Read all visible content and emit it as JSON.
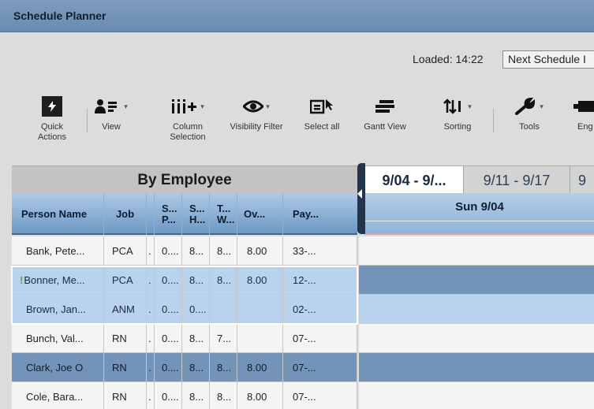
{
  "window": {
    "title": "Schedule Planner"
  },
  "status": {
    "loaded": "Loaded: 14:22",
    "next_button": "Next Schedule I"
  },
  "toolbar": {
    "quick_actions": "Quick Actions",
    "view": "View",
    "column_selection": "Column Selection",
    "visibility_filter": "Visibility Filter",
    "select_all": "Select all",
    "gantt_view": "Gantt View",
    "sorting": "Sorting",
    "tools": "Tools",
    "engine": "Eng"
  },
  "grid": {
    "group_title": "By Employee",
    "headers": {
      "name": "Person Name",
      "job": "Job",
      "c1": "S... P...",
      "c2": "S... H...",
      "c3": "T... W...",
      "ov": "Ov...",
      "pay": "Pay..."
    },
    "rows": [
      {
        "name": "Bank, Pete...",
        "job": "PCA",
        "c1": "0....",
        "c2": "8...",
        "c3": "8...",
        "ov": "8.00",
        "pay": "33-...",
        "flag": ""
      },
      {
        "name": "Bonner, Me...",
        "job": "PCA",
        "c1": "0....",
        "c2": "8...",
        "c3": "8...",
        "ov": "8.00",
        "pay": "12-...",
        "flag": "!"
      },
      {
        "name": "Brown, Jan...",
        "job": "ANM",
        "c1": "0....",
        "c2": "0....",
        "c3": "",
        "ov": "",
        "pay": "02-...",
        "flag": ""
      },
      {
        "name": "Bunch, Val...",
        "job": "RN",
        "c1": "0....",
        "c2": "8...",
        "c3": "7...",
        "ov": "",
        "pay": "07-...",
        "flag": ""
      },
      {
        "name": "Clark, Joe O",
        "job": "RN",
        "c1": "0....",
        "c2": "8...",
        "c3": "8...",
        "ov": "8.00",
        "pay": "07-...",
        "flag": ""
      },
      {
        "name": "Cole, Bara...",
        "job": "RN",
        "c1": "0....",
        "c2": "8...",
        "c3": "8...",
        "ov": "8.00",
        "pay": "07-...",
        "flag": ""
      }
    ]
  },
  "calendar": {
    "tabs": [
      "9/04 - 9/...",
      "9/11 - 9/17",
      "9"
    ],
    "day": "Sun 9/04"
  },
  "colors": {
    "row_white": "#f4f4f4",
    "row_selected": "#b9d3ee",
    "row_dark": "#7394b8",
    "accent": "#3f6791"
  }
}
